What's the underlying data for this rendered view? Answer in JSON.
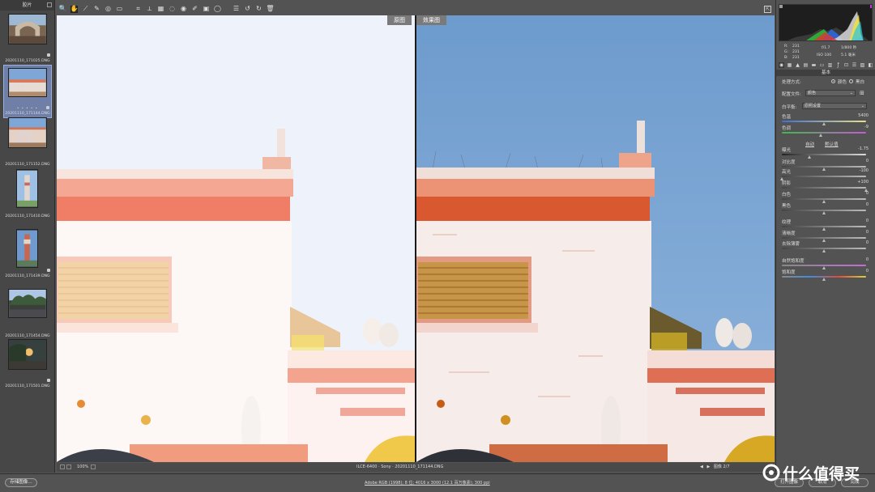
{
  "filmstrip": {
    "title": "胶片",
    "items": [
      {
        "caption": "20201110_171025.DNG",
        "dots": ""
      },
      {
        "caption": "20201110_171144.DNG",
        "dots": "• • • • •"
      },
      {
        "caption": "20201110_171152.DNG",
        "dots": ""
      },
      {
        "caption": "20201110_171410.DNG",
        "dots": ""
      },
      {
        "caption": "20201110_171439.DNG",
        "dots": ""
      },
      {
        "caption": "20201110_171454.DNG",
        "dots": ""
      },
      {
        "caption": "20201110_171501.DNG",
        "dots": ""
      }
    ]
  },
  "toolbar": {
    "tools": [
      "zoom-icon",
      "hand-icon",
      "white-balance-icon",
      "color-sampler-icon",
      "target-adjust-icon",
      "ruler-icon",
      "crop-icon",
      "straighten-icon",
      "transform-icon",
      "spot-removal-icon",
      "red-eye-icon",
      "adjustment-brush-icon",
      "graduated-filter-icon",
      "radial-filter-icon",
      "preferences-icon",
      "rotate-left-icon",
      "rotate-right-icon",
      "trash-icon"
    ],
    "glyphs": [
      "🔍",
      "✋",
      "⟋",
      "✎",
      "◎",
      "▭",
      "⌗",
      "⟂",
      "▦",
      "◌",
      "◉",
      "✐",
      "▣",
      "◯",
      "☰",
      "↺",
      "↻",
      "🗑"
    ]
  },
  "preview": {
    "before_label": "原图",
    "after_label": "效果图"
  },
  "preview_bar": {
    "zoom": "100%",
    "filename": "ILCE-6400 · Sony  ·  20201110_171144.DNG",
    "nav_prev": "◀",
    "nav_next": "▶",
    "nav_text": "图像 2/7"
  },
  "bottom": {
    "save_label": "存储图像...",
    "workflow_link": "Adobe RGB (1998); 8 位; 4016 x 3000 (12.1 百万像素); 300 ppi",
    "open_label": "打开图像",
    "cancel_label": "取消",
    "done_label": "完成"
  },
  "info": {
    "r_label": "R:",
    "r_val": "231",
    "g_label": "G:",
    "g_val": "231",
    "b_label": "B:",
    "b_val": "231",
    "aperture": "f/1.7",
    "shutter": "1/800 秒",
    "iso": "ISO 100",
    "focal": "5.1 毫米"
  },
  "panel": {
    "section": "基本",
    "treatment_label": "处理方式:",
    "treatment_color": "颜色",
    "treatment_bw": "黑白",
    "profile_label": "配置文件:",
    "profile_value": "颜色",
    "wb_label": "白平衡:",
    "wb_value": "原照设置",
    "auto_label": "自动",
    "default_label": "默认值",
    "sliders": [
      {
        "label": "色温",
        "value": "5400",
        "pos": 0.5
      },
      {
        "label": "色调",
        "value": "-9",
        "pos": 0.47
      },
      {
        "label": "曝光",
        "value": "-1.75",
        "pos": 0.33
      },
      {
        "label": "对比度",
        "value": "0",
        "pos": 0.5
      },
      {
        "label": "高光",
        "value": "-100",
        "pos": 0.0
      },
      {
        "label": "阴影",
        "value": "+100",
        "pos": 1.0
      },
      {
        "label": "白色",
        "value": "0",
        "pos": 0.5
      },
      {
        "label": "黑色",
        "value": "0",
        "pos": 0.5
      },
      {
        "label": "纹理",
        "value": "0",
        "pos": 0.5
      },
      {
        "label": "清晰度",
        "value": "0",
        "pos": 0.5
      },
      {
        "label": "去除薄雾",
        "value": "0",
        "pos": 0.5
      },
      {
        "label": "自然饱和度",
        "value": "0",
        "pos": 0.5
      },
      {
        "label": "饱和度",
        "value": "0",
        "pos": 0.5
      }
    ]
  },
  "watermark": {
    "text": "什么值得买"
  }
}
